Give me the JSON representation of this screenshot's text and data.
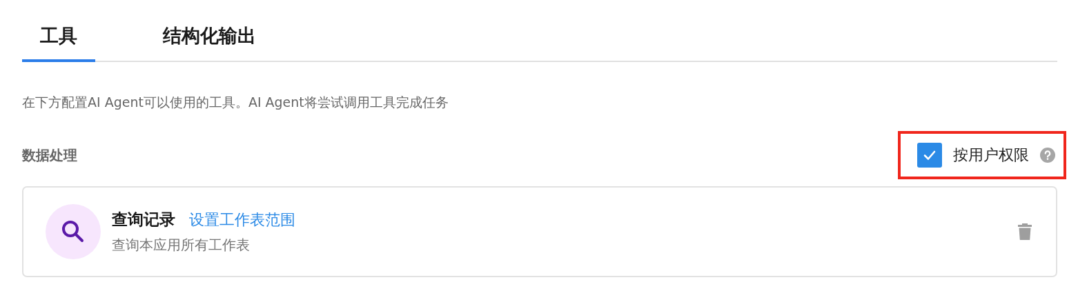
{
  "tabs": [
    {
      "label": "工具",
      "selected": true
    },
    {
      "label": "结构化输出",
      "selected": false
    }
  ],
  "description": "在下方配置AI Agent可以使用的工具。AI Agent将尝试调用工具完成任务",
  "section": {
    "title": "数据处理",
    "permission": {
      "label": "按用户权限",
      "checked": true,
      "highlighted": true
    }
  },
  "tools": [
    {
      "name": "查询记录",
      "link": "设置工作表范围",
      "description": "查询本应用所有工作表"
    }
  ]
}
